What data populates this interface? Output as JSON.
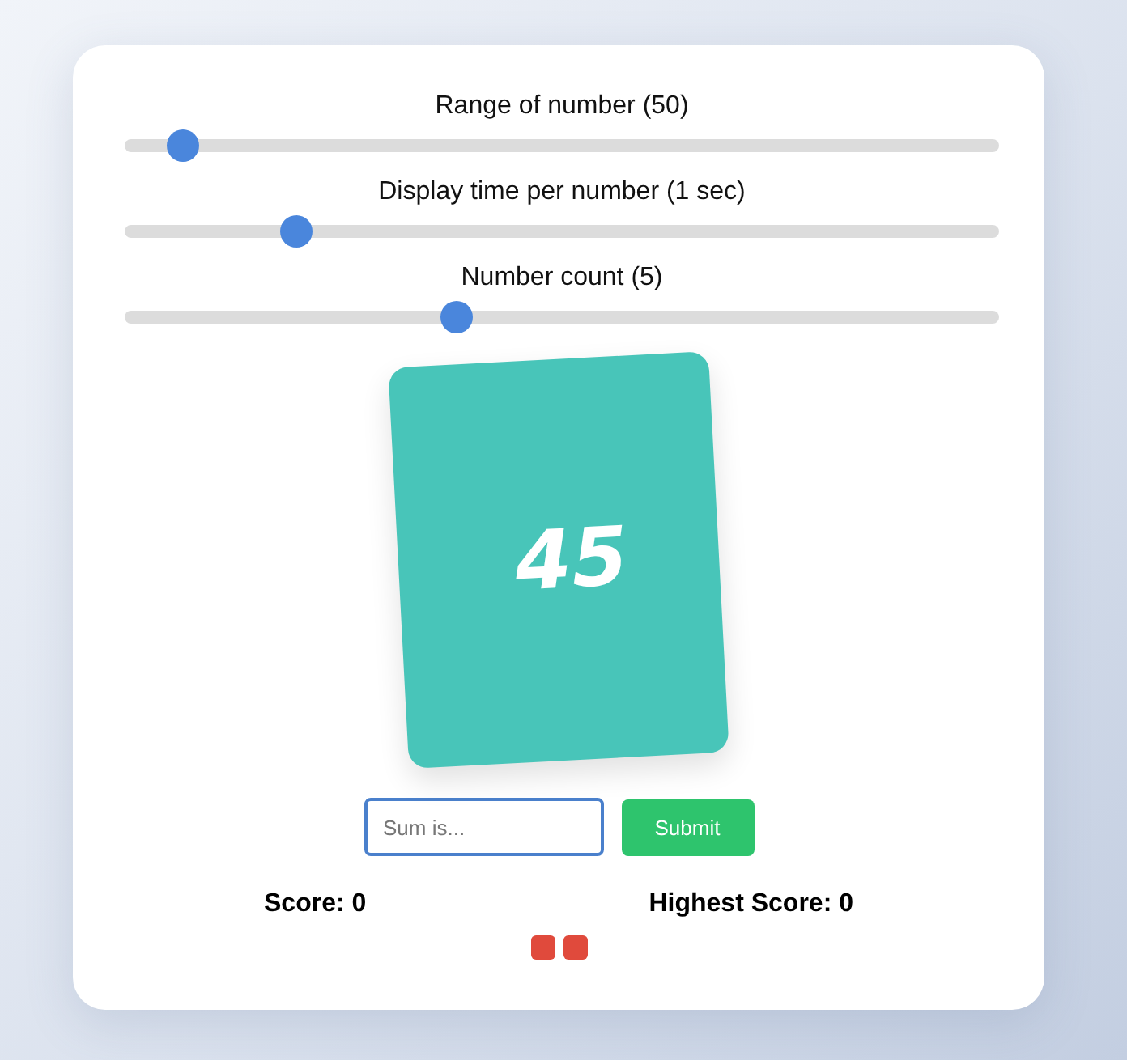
{
  "sliders": [
    {
      "label": "Range of number (50)",
      "level": 0.05
    },
    {
      "label": "Display time per number (1 sec)",
      "level": 0.185
    },
    {
      "label": "Number count (5)",
      "level": 0.375
    }
  ],
  "card": {
    "number": "45"
  },
  "answer": {
    "placeholder": "Sum is...",
    "focused": true
  },
  "submit": {
    "label": "Submit"
  },
  "scores": [
    {
      "text": "Score: 0"
    },
    {
      "text": "Highest Score: 0"
    }
  ],
  "markers": [
    {
      "color": "#e04a3c"
    },
    {
      "color": "#e04a3c"
    }
  ]
}
